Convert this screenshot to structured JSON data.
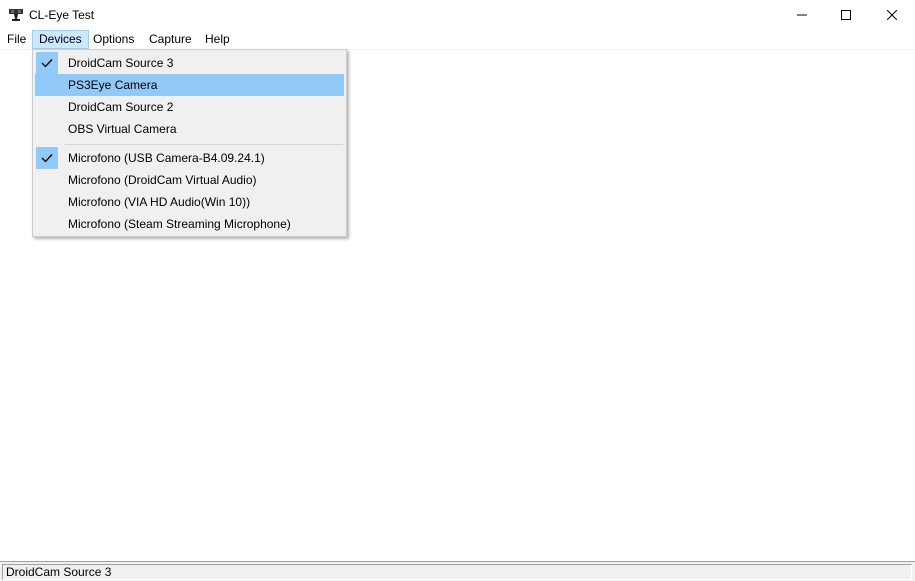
{
  "window": {
    "title": "CL-Eye Test",
    "app_icon": "webcam-icon"
  },
  "controls": {
    "minimize_icon": "minimize-icon",
    "maximize_icon": "maximize-icon",
    "close_icon": "close-icon"
  },
  "menubar": {
    "items": [
      {
        "label": "File"
      },
      {
        "label": "Devices",
        "active": true
      },
      {
        "label": "Options"
      },
      {
        "label": "Capture"
      },
      {
        "label": "Help"
      }
    ]
  },
  "devices_menu": {
    "video": [
      {
        "label": "DroidCam Source 3",
        "checked": true
      },
      {
        "label": "PS3Eye Camera",
        "highlighted": true
      },
      {
        "label": "DroidCam Source 2"
      },
      {
        "label": "OBS Virtual Camera"
      }
    ],
    "audio": [
      {
        "label": "Microfono (USB Camera-B4.09.24.1)",
        "checked": true
      },
      {
        "label": "Microfono (DroidCam Virtual Audio)"
      },
      {
        "label": "Microfono (VIA HD Audio(Win 10))"
      },
      {
        "label": "Microfono (Steam Streaming Microphone)"
      }
    ]
  },
  "status": {
    "text": "DroidCam Source 3"
  },
  "colors": {
    "menu_highlight": "#91c9f7",
    "menubar_active": "#cce8ff",
    "menu_background": "#f0f0f0"
  }
}
